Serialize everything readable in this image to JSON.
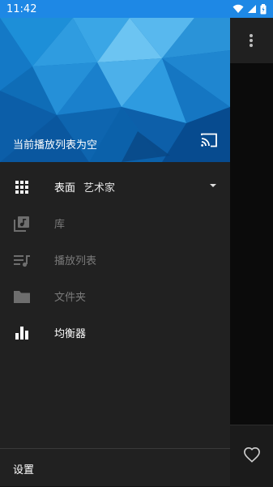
{
  "status_bar": {
    "time": "11:42",
    "icons": [
      "wifi-icon",
      "signal-icon",
      "battery-icon"
    ]
  },
  "drawer": {
    "header_title": "当前播放列表为空",
    "cast_icon": "cast-icon",
    "items": [
      {
        "icon": "grid-icon",
        "label": "表面",
        "value": "艺术家",
        "state": "active",
        "has_dropdown": true
      },
      {
        "icon": "library-music-icon",
        "label": "库",
        "state": "disabled"
      },
      {
        "icon": "playlist-icon",
        "label": "播放列表",
        "state": "disabled"
      },
      {
        "icon": "folder-icon",
        "label": "文件夹",
        "state": "disabled"
      },
      {
        "icon": "equalizer-icon",
        "label": "均衡器",
        "state": "active"
      }
    ],
    "footer_label": "设置"
  },
  "background_app": {
    "overflow_icon": "more-vert-icon",
    "heart_icon": "heart-icon"
  },
  "colors": {
    "status_bar": "#1e88e5",
    "drawer_bg": "#212121",
    "header_blue": "#0b79c9"
  }
}
